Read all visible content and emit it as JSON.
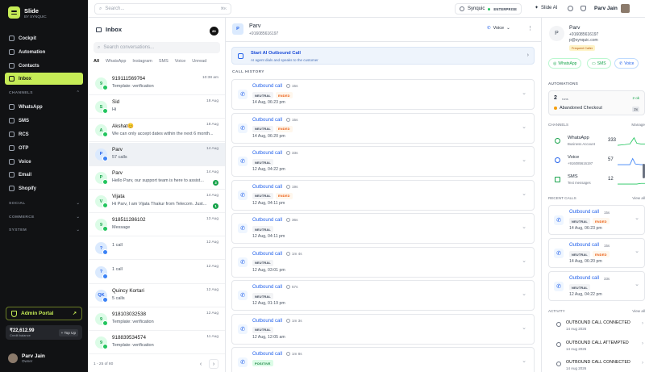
{
  "app": {
    "name": "Slide",
    "tagline": "BY SYNQUIC"
  },
  "sidebar": {
    "items": [
      {
        "label": "Cockpit"
      },
      {
        "label": "Automation"
      },
      {
        "label": "Contacts"
      },
      {
        "label": "Inbox"
      }
    ],
    "channels_heading": "CHANNELS",
    "channels": [
      {
        "label": "WhatsApp"
      },
      {
        "label": "SMS"
      },
      {
        "label": "RCS"
      },
      {
        "label": "OTP"
      },
      {
        "label": "Voice"
      },
      {
        "label": "Email"
      },
      {
        "label": "Shopify"
      }
    ],
    "sections": [
      {
        "label": "SOCIAL"
      },
      {
        "label": "COMMERCE"
      },
      {
        "label": "SYSTEM"
      }
    ],
    "admin_label": "Admin Portal",
    "credits": {
      "amount": "₹22,612.99",
      "label": "Credit balance",
      "topup": "+ Top Up"
    },
    "user": {
      "name": "Parv Jain",
      "role": "Owner"
    }
  },
  "topbar": {
    "search_placeholder": "Search...",
    "search_shortcut": "⌘K",
    "workspace": "Synquic",
    "plan": "ENTERPRISE",
    "slide_ai": "Slide AI",
    "user_name": "Parv Jain"
  },
  "inbox": {
    "title": "Inbox",
    "count_badge": "80",
    "search_placeholder": "Search conversations...",
    "tabs": [
      "All",
      "WhatsApp",
      "Instagram",
      "SMS",
      "Voice",
      "Unread"
    ],
    "conversations": [
      {
        "avatar": "9",
        "name": "919111569764",
        "msg": "Template: verification",
        "time": "10:38 am",
        "badge": "",
        "color": "green"
      },
      {
        "avatar": "S",
        "name": "Sid",
        "msg": "Hi",
        "time": "18 Aug",
        "badge": "",
        "color": "green"
      },
      {
        "avatar": "A",
        "name": "Akshat😊",
        "msg": "We can only accept dates within the next 6 month...",
        "time": "18 Aug",
        "badge": "",
        "color": "green"
      },
      {
        "avatar": "P",
        "name": "Parv",
        "msg": "57 calls",
        "time": "14 Aug",
        "badge": "",
        "color": "blue"
      },
      {
        "avatar": "P",
        "name": "Parv",
        "msg": "Hello Parv, our support team is here to assist...",
        "time": "14 Aug",
        "badge": "3",
        "color": "green"
      },
      {
        "avatar": "V",
        "name": "Vijata",
        "msg": "Hi Parv, I am Vijata Thakur from Telecom. Just...",
        "time": "14 Aug",
        "badge": "1",
        "color": "green"
      },
      {
        "avatar": "9",
        "name": "918511286102",
        "msg": "Message",
        "time": "13 Aug",
        "badge": "",
        "color": "green"
      },
      {
        "avatar": "?",
        "name": "",
        "msg": "1 call",
        "time": "12 Aug",
        "badge": "",
        "color": "blue"
      },
      {
        "avatar": "?",
        "name": "",
        "msg": "1 call",
        "time": "12 Aug",
        "badge": "",
        "color": "blue"
      },
      {
        "avatar": "QK",
        "name": "Quincy Kortari",
        "msg": "5 calls",
        "time": "12 Aug",
        "badge": "",
        "color": "blue"
      },
      {
        "avatar": "9",
        "name": "918103032538",
        "msg": "Template: verification",
        "time": "12 Aug",
        "badge": "",
        "color": "green"
      },
      {
        "avatar": "9",
        "name": "918839534574",
        "msg": "Template: verification",
        "time": "11 Aug",
        "badge": "",
        "color": "green"
      }
    ],
    "pagination": "1 - 25 of 80"
  },
  "contact_header": {
    "avatar": "P",
    "name": "Parv",
    "phone": "+916085616197",
    "channel": "Voice"
  },
  "ai_call": {
    "title": "Start AI Outbound Call",
    "subtitle": "AI agent dials and speaks to the customer"
  },
  "call_history": {
    "heading": "CALL HISTORY",
    "calls": [
      {
        "type": "Outbound call",
        "duration": "15s",
        "tags": [
          "NEUTRAL",
          "ENDED"
        ],
        "date": "14 Aug, 06:23 pm"
      },
      {
        "type": "Outbound call",
        "duration": "15s",
        "tags": [
          "NEUTRAL",
          "ENDED"
        ],
        "date": "14 Aug, 06:20 pm"
      },
      {
        "type": "Outbound call",
        "duration": "33s",
        "tags": [
          "NEUTRAL"
        ],
        "date": "12 Aug, 04:22 pm"
      },
      {
        "type": "Outbound call",
        "duration": "19s",
        "tags": [
          "NEUTRAL",
          "ENDED"
        ],
        "date": "12 Aug, 04:11 pm"
      },
      {
        "type": "Outbound call",
        "duration": "36s",
        "tags": [
          "NEUTRAL"
        ],
        "date": "12 Aug, 04:11 pm"
      },
      {
        "type": "Outbound call",
        "duration": "1m 4s",
        "tags": [
          "NEUTRAL"
        ],
        "date": "12 Aug, 03:01 pm"
      },
      {
        "type": "Outbound call",
        "duration": "57s",
        "tags": [
          "NEUTRAL"
        ],
        "date": "12 Aug, 01:19 pm"
      },
      {
        "type": "Outbound call",
        "duration": "1m 3s",
        "tags": [
          "NEUTRAL"
        ],
        "date": "12 Aug, 12:05 am"
      },
      {
        "type": "Outbound call",
        "duration": "1m 8s",
        "tags": [
          "POSITIVE"
        ],
        "date": ""
      }
    ]
  },
  "profile": {
    "avatar": "P",
    "name": "Parv",
    "phone": "+916085616197",
    "email": "p@synquic.com",
    "badge": "Frequent Caller",
    "channels": [
      "WhatsApp",
      "SMS",
      "Voice"
    ]
  },
  "automations": {
    "heading": "AUTOMATIONS",
    "runs": "2",
    "runs_label": "runs",
    "ok": "2 ok",
    "item": "Abandoned Checkout",
    "item_count": "2x"
  },
  "channels_panel": {
    "heading": "CHANNELS",
    "manage": "Manage",
    "rows": [
      {
        "name": "WhatsApp",
        "sub": "Business Account",
        "count": "333"
      },
      {
        "name": "Voice",
        "sub": "+916085616197",
        "count": "57"
      },
      {
        "name": "SMS",
        "sub": "Text messages",
        "count": "12"
      }
    ]
  },
  "recent_calls": {
    "heading": "RECENT CALLS",
    "view_all": "View all",
    "calls": [
      {
        "type": "Outbound call",
        "duration": "15s",
        "tags": [
          "NEUTRAL",
          "ENDED"
        ],
        "date": "14 Aug, 06:23 pm"
      },
      {
        "type": "Outbound call",
        "duration": "15s",
        "tags": [
          "NEUTRAL",
          "ENDED"
        ],
        "date": "14 Aug, 06:20 pm"
      },
      {
        "type": "Outbound call",
        "duration": "33s",
        "tags": [
          "NEUTRAL"
        ],
        "date": "12 Aug, 04:22 pm"
      }
    ]
  },
  "activity": {
    "heading": "ACTIVITY",
    "view_all": "View all",
    "items": [
      {
        "title": "OUTBOUND CALL CONNECTED",
        "date": "14 Aug 2026"
      },
      {
        "title": "OUTBOUND CALL ATTEMPTED",
        "date": "14 Aug 2026"
      },
      {
        "title": "OUTBOUND CALL CONNECTED",
        "date": "14 Aug 2026"
      }
    ]
  },
  "colors": {
    "accent": "#c6ec56",
    "sidebar_bg": "#111214",
    "link": "#2563eb"
  }
}
